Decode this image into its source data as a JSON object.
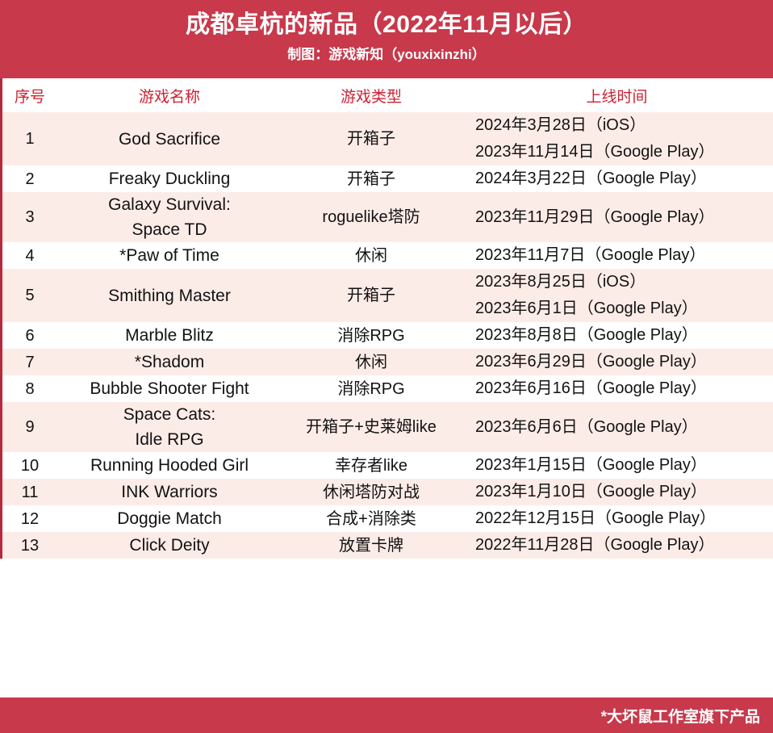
{
  "header": {
    "title": "成都卓杭的新品（2022年11月以后）",
    "subtitle": "制图：游戏新知（youxixinzhi）",
    "band_color": "#c7394b"
  },
  "table": {
    "columns": [
      {
        "key": "index",
        "label": "序号"
      },
      {
        "key": "name",
        "label": "游戏名称"
      },
      {
        "key": "type",
        "label": "游戏类型"
      },
      {
        "key": "date",
        "label": "上线时间"
      }
    ],
    "header_text_color": "#cc2233",
    "stripe_color": "#fcece8",
    "rows": [
      {
        "index": "1",
        "name": "God Sacrifice",
        "type": "开箱子",
        "dates": [
          "2024年3月28日（iOS）",
          "2023年11月14日（Google Play）"
        ]
      },
      {
        "index": "2",
        "name": "Freaky Duckling",
        "type": "开箱子",
        "dates": [
          "2024年3月22日（Google Play）"
        ]
      },
      {
        "index": "3",
        "name": "Galaxy Survival:\nSpace TD",
        "type": "roguelike塔防",
        "dates": [
          "2023年11月29日（Google Play）"
        ]
      },
      {
        "index": "4",
        "name": "*Paw of Time",
        "type": "休闲",
        "dates": [
          "2023年11月7日（Google Play）"
        ]
      },
      {
        "index": "5",
        "name": "Smithing Master",
        "type": "开箱子",
        "dates": [
          "2023年8月25日（iOS）",
          "2023年6月1日（Google Play）"
        ]
      },
      {
        "index": "6",
        "name": "Marble Blitz",
        "type": "消除RPG",
        "dates": [
          "2023年8月8日（Google Play）"
        ]
      },
      {
        "index": "7",
        "name": "*Shadom",
        "type": "休闲",
        "dates": [
          "2023年6月29日（Google Play）"
        ]
      },
      {
        "index": "8",
        "name": "Bubble Shooter Fight",
        "type": "消除RPG",
        "dates": [
          "2023年6月16日（Google Play）"
        ]
      },
      {
        "index": "9",
        "name": "Space Cats:\nIdle RPG",
        "type": "开箱子+史莱姆like",
        "dates": [
          "2023年6月6日（Google Play）"
        ]
      },
      {
        "index": "10",
        "name": "Running Hooded Girl",
        "type": "幸存者like",
        "dates": [
          "2023年1月15日（Google Play）"
        ]
      },
      {
        "index": "11",
        "name": "INK Warriors",
        "type": "休闲塔防对战",
        "dates": [
          "2023年1月10日（Google Play）"
        ]
      },
      {
        "index": "12",
        "name": "Doggie Match",
        "type": "合成+消除类",
        "dates": [
          "2022年12月15日（Google Play）"
        ]
      },
      {
        "index": "13",
        "name": "Click Deity",
        "type": "放置卡牌",
        "dates": [
          "2022年11月28日（Google Play）"
        ]
      }
    ]
  },
  "footer": {
    "note": "*大坏鼠工作室旗下产品",
    "band_color": "#c7394b"
  }
}
